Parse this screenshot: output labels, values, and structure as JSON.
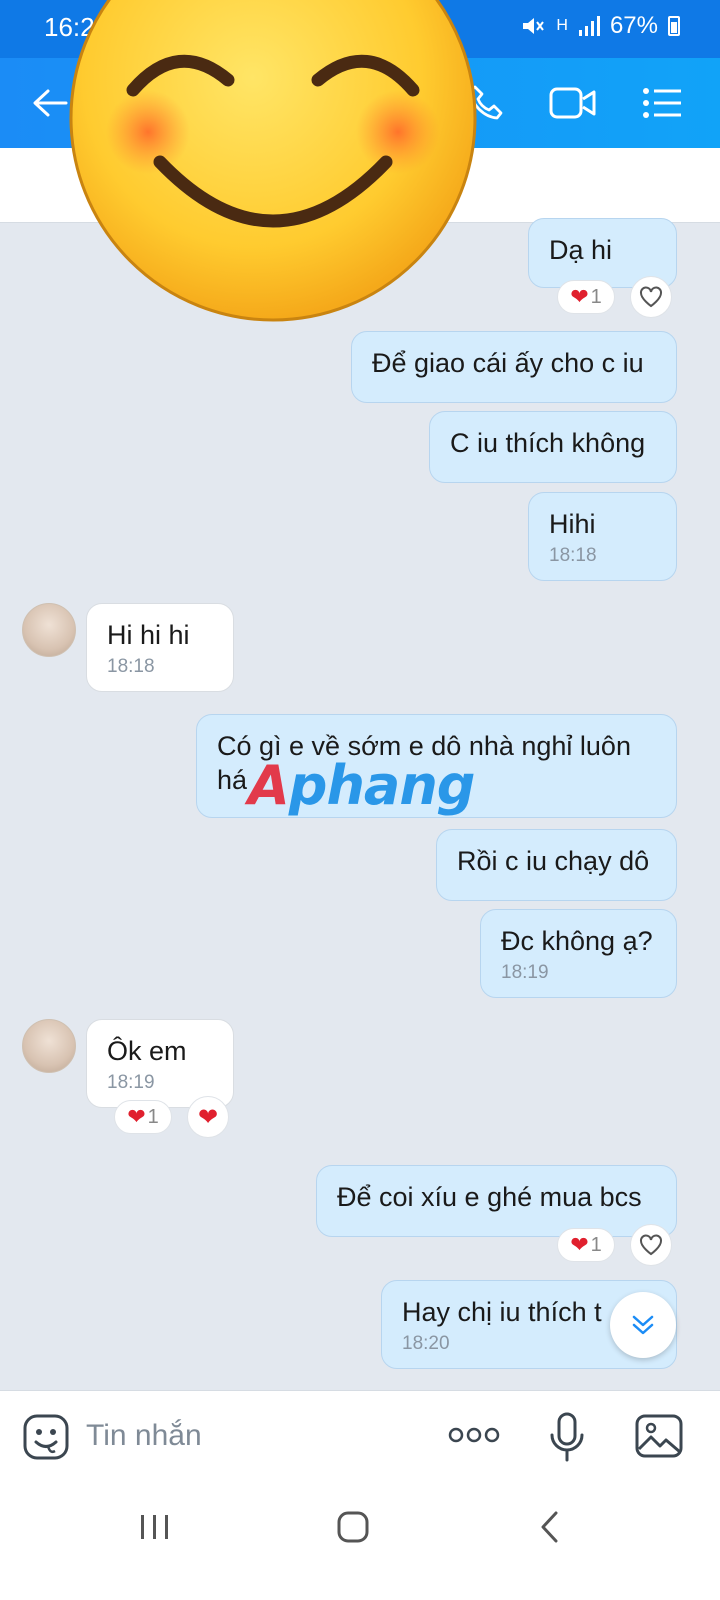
{
  "status_bar": {
    "time": "16:2",
    "network": "H",
    "battery": "67%"
  },
  "messages": [
    {
      "id": "m1",
      "side": "out",
      "text": "Dạ hi",
      "time": ""
    },
    {
      "id": "m2",
      "side": "out",
      "text": "Để giao cái ấy cho c iu",
      "time": ""
    },
    {
      "id": "m3",
      "side": "out",
      "text": "C iu thích không",
      "time": ""
    },
    {
      "id": "m4",
      "side": "out",
      "text": "Hihi",
      "time": "18:18"
    },
    {
      "id": "m5",
      "side": "in",
      "text": "Hi hi hi",
      "time": "18:18"
    },
    {
      "id": "m6",
      "side": "out",
      "text": "Có gì e về sớm e dô nhà nghỉ luôn",
      "text2": "há",
      "time": ""
    },
    {
      "id": "m7",
      "side": "out",
      "text": "Rồi c iu chạy dô",
      "time": ""
    },
    {
      "id": "m8",
      "side": "out",
      "text": "Đc không ạ?",
      "time": "18:19"
    },
    {
      "id": "m9",
      "side": "in",
      "text": "Ôk em",
      "time": "18:19"
    },
    {
      "id": "m10",
      "side": "out",
      "text": "Để coi xíu e ghé mua bcs",
      "time": ""
    },
    {
      "id": "m11",
      "side": "out",
      "text": "Hay chị iu thích t",
      "time": "18:20"
    }
  ],
  "reactions": {
    "m1_count": "1",
    "m9_count": "1",
    "m10_count": "1"
  },
  "watermark": "Aphang",
  "input": {
    "placeholder": "Tin nhắn"
  },
  "colors": {
    "header": "#1b8cf6",
    "outgoing_bubble": "#d4ecfd",
    "incoming_bubble": "#ffffff",
    "heart": "#e0202e"
  }
}
